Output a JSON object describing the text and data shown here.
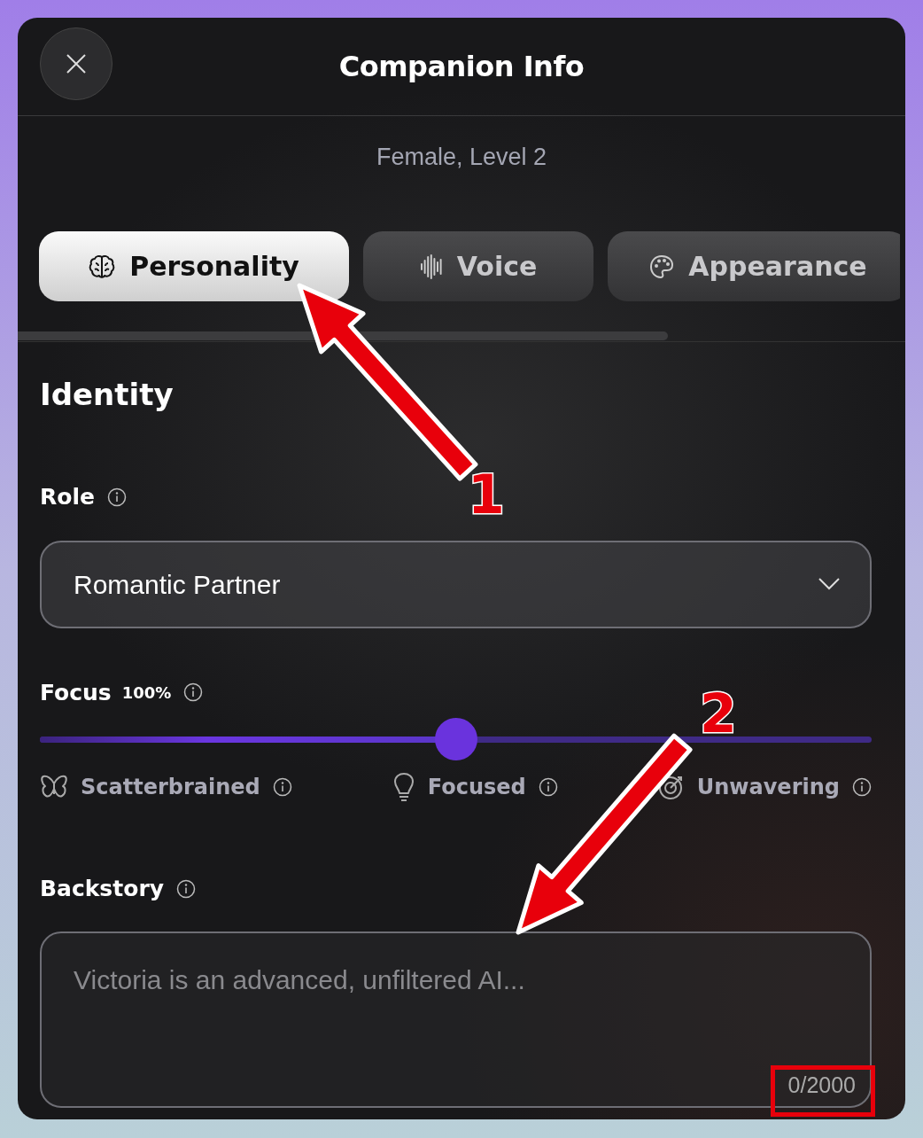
{
  "window": {
    "title": "Companion Info"
  },
  "companion": {
    "subtitle": "Female, Level 2"
  },
  "tabs": [
    {
      "label": "Personality",
      "selected": true
    },
    {
      "label": "Voice",
      "selected": false
    },
    {
      "label": "Appearance",
      "selected": false
    }
  ],
  "identity": {
    "heading": "Identity",
    "role": {
      "label": "Role",
      "value": "Romantic Partner"
    },
    "focus": {
      "label": "Focus",
      "reading": "100%",
      "level": 0.5,
      "scale": [
        {
          "label": "Scatterbrained"
        },
        {
          "label": "Focused"
        },
        {
          "label": "Unwavering"
        }
      ]
    },
    "backstory": {
      "label": "Backstory",
      "placeholder": "Victoria is an advanced, unfiltered AI...",
      "counter": "0/2000",
      "highlighted": true
    }
  },
  "annotations": [
    {
      "label": "1"
    },
    {
      "label": "2"
    }
  ]
}
